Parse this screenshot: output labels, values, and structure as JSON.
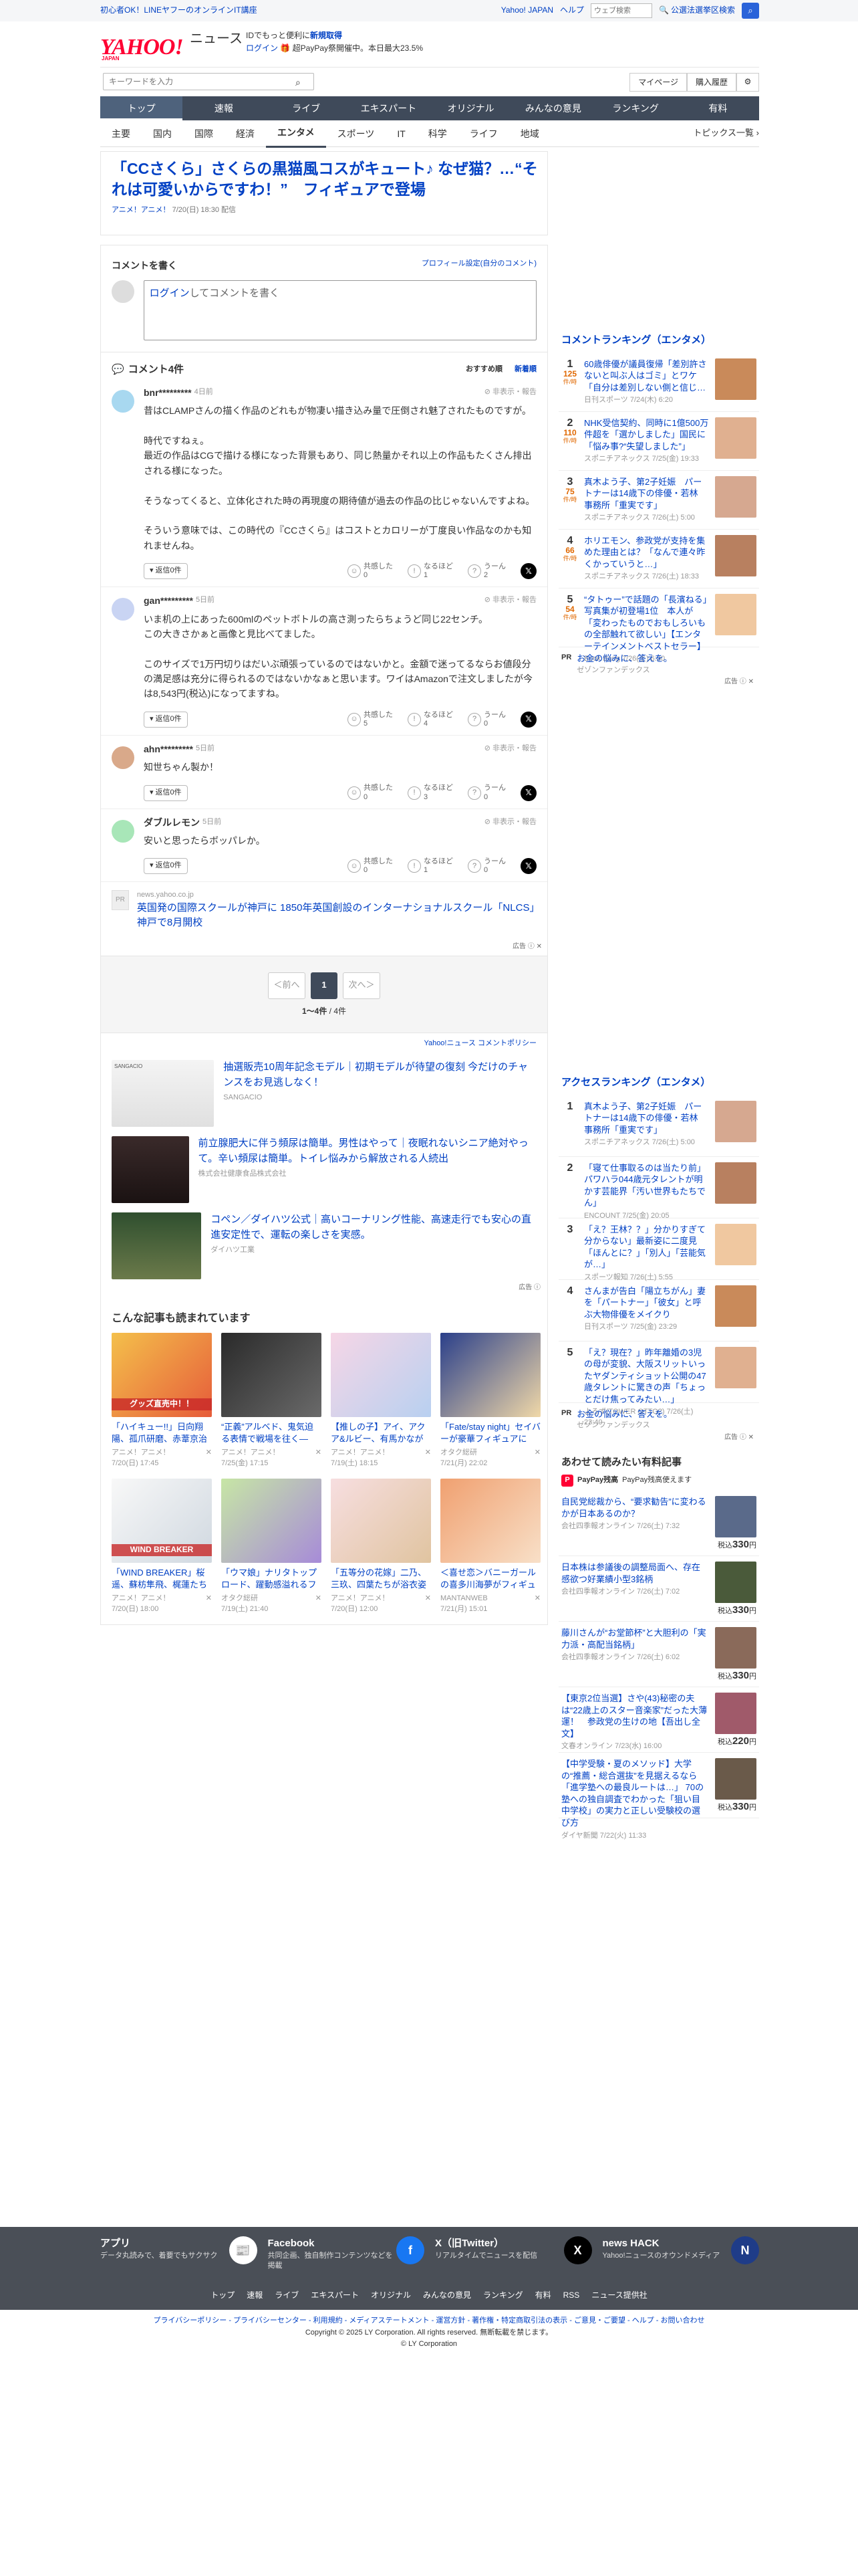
{
  "topbar": {
    "promo": "初心者OK！LINEヤフーのオンラインIT講座",
    "yahoo_japan": "Yahoo! JAPAN",
    "help": "ヘルプ",
    "web_search_placeholder": "ウェブ検索",
    "civil_search": "公選法選挙区検索"
  },
  "header": {
    "logo": "YAHOO!",
    "logo_sub": "ニュース",
    "logo_jp": "JAPAN",
    "line1": "IDでもっと便利に",
    "signup": "新規取得",
    "login": "ログイン",
    "paypay": "超PayPay祭開催中。本日最大23.5%"
  },
  "search": {
    "placeholder": "キーワードを入力",
    "mypage": "マイページ",
    "history": "購入履歴"
  },
  "nav1": [
    "トップ",
    "速報",
    "ライブ",
    "エキスパート",
    "オリジナル",
    "みんなの意見",
    "ランキング",
    "有料"
  ],
  "nav2": [
    "主要",
    "国内",
    "国際",
    "経済",
    "エンタメ",
    "スポーツ",
    "IT",
    "科学",
    "ライフ",
    "地域"
  ],
  "nav2_topics": "トピックス一覧",
  "article": {
    "title": "「CCさくら」さくらの黒猫風コスがキュート♪ なぜ猫？…“それは可愛いからですわ！”　フィギュアで登場",
    "source": "アニメ！アニメ！",
    "date": "7/20(日) 18:30 配信"
  },
  "comment_write": {
    "title": "コメントを書く",
    "profile": "プロフィール設定(自分のコメント)",
    "login": "ログイン",
    "placeholder": "してコメントを書く"
  },
  "comments": {
    "title": "コメント4件",
    "sort_rec": "おすすめ順",
    "sort_new": "新着順",
    "reply_label": "返信0件",
    "report": "非表示・報告",
    "r1": "共感した",
    "r2": "なるほど",
    "r3": "うーん",
    "items": [
      {
        "name": "bnr*********",
        "ago": "4日前",
        "body": "昔はCLAMPさんの描く作品のどれもが物凄い描き込み量で圧倒され魅了されたものですが。\n\n時代ですねぇ。\n最近の作品はCGで描ける様になった背景もあり、同じ熱量かそれ以上の作品もたくさん排出される様になった。\n\nそうなってくると、立体化された時の再現度の期待値が過去の作品の比じゃないんですよね。\n\nそういう意味では、この時代の『CCさくら』はコストとカロリーが丁度良い作品なのかも知れませんね。",
        "c1": "0",
        "c2": "1",
        "c3": "2"
      },
      {
        "name": "gan*********",
        "ago": "5日前",
        "body": "いま机の上にあった600mlのペットボトルの高さ測ったらちょうど同じ22センチ。\nこの大きさかぁと画像と見比べてました。\n\nこのサイズで1万円切りはだいぶ頑張っているのではないかと。金額で迷ってるならお値段分の満足感は充分に得られるのではないかなぁと思います。ワイはAmazonで注文しましたが今は8,543円(税込)になってますね。",
        "c1": "5",
        "c2": "4",
        "c3": "0"
      },
      {
        "name": "ahn*********",
        "ago": "5日前",
        "body": "知世ちゃん製か！",
        "c1": "0",
        "c2": "3",
        "c3": "0"
      },
      {
        "name": "ダブルレモン",
        "ago": "5日前",
        "body": "安いと思ったらボッパレか。",
        "c1": "0",
        "c2": "1",
        "c3": "0"
      }
    ]
  },
  "promo1": {
    "icon": "PR",
    "source": "news.yahoo.co.jp",
    "title": "英国発の国際スクールが神戸に 1850年英国創設のインターナショナルスクール「NLCS」神戸で8月開校",
    "ad": "広告"
  },
  "pager": {
    "prev": "＜前へ",
    "page": "1",
    "next": "次へ＞",
    "count": "1〜4件",
    "total": "/ 4件"
  },
  "policy": "Yahoo!ニュース コメントポリシー",
  "ads": [
    {
      "title": "抽選販売10周年記念モデル｜初期モデルが待望の復刻 今だけのチャンスをお見逃しなく！",
      "sponsor": "SANGACIO",
      "label": "SANGACIO"
    },
    {
      "title": "前立腺肥大に伴う頻尿は簡単。男性はやって｜夜眠れないシニア絶対やって。辛い頻尿は簡単。トイレ悩みから解放される人続出",
      "sponsor": "株式会社健康食品株式会社"
    },
    {
      "title": "コペン／ダイハツ公式｜高いコーナリング性能、高速走行でも安心の直進安定性で、運転の楽しさを実感。",
      "sponsor": "ダイハツ工業"
    }
  ],
  "ads_label": "広告",
  "read": {
    "title": "こんな記事も読まれています",
    "items": [
      {
        "title": "「ハイキュー!!」日向翔陽、孤爪研磨、赤葦京治たちが躍動！トレ…",
        "src": "アニメ！アニメ！",
        "date": "7/20(日) 17:45",
        "label": "グッズ直売中！！"
      },
      {
        "title": "“正義”アルベド、鬼気迫る表情で戦場を往く―「オーバーロード…",
        "src": "アニメ！アニメ！",
        "date": "7/25(金) 17:15"
      },
      {
        "title": "【推しの子】アイ、アクア&ルビー、有馬かなが お買い物? 日常…",
        "src": "アニメ！アニメ！",
        "date": "7/19(土) 18:15"
      },
      {
        "title": "「Fate/stay night」セイバーが豪華フィギュアに　聖剣「カリバ…",
        "src": "オタク総研",
        "date": "7/21(月) 22:02"
      },
      {
        "title": "「WIND BREAKER」桜遥、蘇枋隼飛、梶蓮たちが、“ぷちキャラ…",
        "src": "アニメ！アニメ！",
        "date": "7/20(日) 18:00",
        "label": "WIND BREAKER"
      },
      {
        "title": "「ウマ娘」ナリタトップロード、躍動感溢れるフィギュアに！普…",
        "src": "オタク総研",
        "date": "7/19(土) 21:40"
      },
      {
        "title": "「五等分の花嫁」二乃、三玖、四葉たちが浴衣姿で納涼♪夏と…",
        "src": "アニメ！アニメ！",
        "date": "7/20(日) 12:00"
      },
      {
        "title": "＜喜せ恋＞バニーガールの喜多川海夢がフィギュアに　健康的な…",
        "src": "MANTANWEB",
        "date": "7/21(月) 15:01"
      }
    ]
  },
  "side": {
    "comment_rank_title": "コメントランキング（エンタメ）",
    "unit": "件/時",
    "comment_rank": [
      {
        "n": "1",
        "c": "125",
        "title": "60歳俳優が議員復帰「差別許さないと叫ぶ人はゴミ」とワケ「自分は差別しない側と信じ…",
        "src": "日刊スポーツ 7/24(木) 6:20"
      },
      {
        "n": "2",
        "c": "110",
        "title": "NHK受信契約、同時に1億500万件超を「選かしました」国民に「悩み事?“失望しました”」",
        "src": "スポニチアネックス 7/25(金) 19:33"
      },
      {
        "n": "3",
        "c": "75",
        "title": "真木よう子、第2子妊娠　パートナーは14歳下の俳優・若林　事務所「重実です」",
        "src": "スポニチアネックス 7/26(土) 5:00"
      },
      {
        "n": "4",
        "c": "66",
        "title": "ホリエモン、参政党が支持を集めた理由とは？「なんで連々昨くかっていうと…」",
        "src": "スポニチアネックス 7/26(土) 18:33"
      },
      {
        "n": "5",
        "c": "54",
        "title": "“タトゥー”で話題の「長濱ねる」写真集が初登場1位　本人が「変わったものでおもしろいもの全部触れて欲しい」【エンターテインメントベストセラー】",
        "src": "Book Bang 7/26(土) 6:00"
      }
    ],
    "pr1": {
      "label": "PR",
      "title": "お金の悩みに、答えを。",
      "sponsor": "ゼゾンファンデックス",
      "ad": "広告"
    },
    "access_rank_title": "アクセスランキング（エンタメ）",
    "access_rank": [
      {
        "n": "1",
        "title": "真木よう子、第2子妊娠　パートナーは14歳下の俳優・若林　事務所「重実です」",
        "src": "スポニチアネックス 7/26(土) 5:00"
      },
      {
        "n": "2",
        "title": "「寝て仕事取るのは当たり前」パワハラ044歳元タレントが明かす芸能界「汚い世界もたちでん」",
        "src": "ENCOUNT 7/25(金) 20:05"
      },
      {
        "n": "3",
        "title": "「え？王林？？」分かりすぎて分からない」最新姿に二度見「ほんとに？」「別人」「芸能気が…」",
        "src": "スポーツ報知 7/26(土) 5:55"
      },
      {
        "n": "4",
        "title": "さんまが告白「陽立ちがん」妻を「パートナー」「彼女」と呼ぶ大物俳優をメイクり",
        "src": "日刊スポーツ 7/25(金) 23:29"
      },
      {
        "n": "5",
        "title": "「え？現在？」昨年離婚の3児の母が変貌、大阪スリットいったヤダンティショット公開の47歳タレントに驚きの声「ちょっとだけ焦ってみたい…」",
        "src": "よろず(TOWER OTTO?) 7/26(土) 23:40"
      }
    ],
    "pr2": {
      "label": "PR",
      "title": "お金の悩みに、答えを。",
      "sponsor": "ゼゾンファンデックス",
      "ad": "広告"
    },
    "shop_title": "あわせて読みたい有料記事",
    "paypay_label": "PayPay残高",
    "paypay_desc": "PayPay残高使えます",
    "shop": [
      {
        "title": "自民党総裁から、“要求勧告”に変わるかが日本あるのか？",
        "src": "会社四季報オンライン 7/26(土) 7:32",
        "price": "330",
        "unit": "円",
        "pre": "税込"
      },
      {
        "title": "日本株は参議後の調整局面へ、存在感欲つ好業績小型3銘柄",
        "src": "会社四季報オンライン 7/26(土) 7:02",
        "price": "330",
        "unit": "円",
        "pre": "税込"
      },
      {
        "title": "藤川さんが“お堂節杯”と大胆利の「実力派・高配当銘柄」",
        "src": "会社四季報オンライン 7/26(土) 6:02",
        "price": "330",
        "unit": "円",
        "pre": "税込"
      },
      {
        "title": "【東京2位当選】さや(43)秘密の夫は“22歳上のスター音楽家”だった大薄運！　参政党の生けの地【吾出し全文】",
        "src": "文春オンライン 7/23(水) 16:00",
        "price": "220",
        "unit": "円",
        "pre": "税込"
      },
      {
        "title": "【中学受験・夏のメソッド】大学の“推薦・総合選抜”を見据えるなら「進学塾への最良ルートは…」 70の塾への独自調査でわかった「狙い目中学校」の実力と正しい受験校の選び方",
        "src": "ダイヤ新聞 7/22(火) 11:33",
        "price": "330",
        "unit": "円",
        "pre": "税込"
      }
    ]
  },
  "footer": {
    "apps": [
      {
        "title": "アプリ",
        "desc": "データ丸読みで、着要でもサクサク",
        "icon": "📰"
      },
      {
        "title": "Facebook",
        "desc": "共同企画、独自制作コンテンツなどを掲載",
        "icon": "f"
      },
      {
        "title": "X（旧Twitter）",
        "desc": "リアルタイムでニュースを配信",
        "icon": "X"
      },
      {
        "title": "news HACK",
        "desc": "Yahoo!ニュースのオウンドメディア",
        "icon": "N"
      }
    ],
    "links": [
      "トップ",
      "速報",
      "ライブ",
      "エキスパート",
      "オリジナル",
      "みんなの意見",
      "ランキング",
      "有料",
      "RSS",
      "ニュース提供社"
    ],
    "legal": "プライバシーポリシー - プライバシーセンター - 利用規約 - メディアステートメント - 運営方針 - 著作権・特定商取引法の表示 - ご意見・ご要望 - ヘルプ - お問い合わせ",
    "copyright": "Copyright © 2025 LY Corporation. All rights reserved. 無断転載を禁じます。",
    "corp": "© LY Corporation"
  },
  "colors": {
    "link": "#0040c4",
    "nav": "#3f4a5a",
    "accent": "#ff0033"
  }
}
